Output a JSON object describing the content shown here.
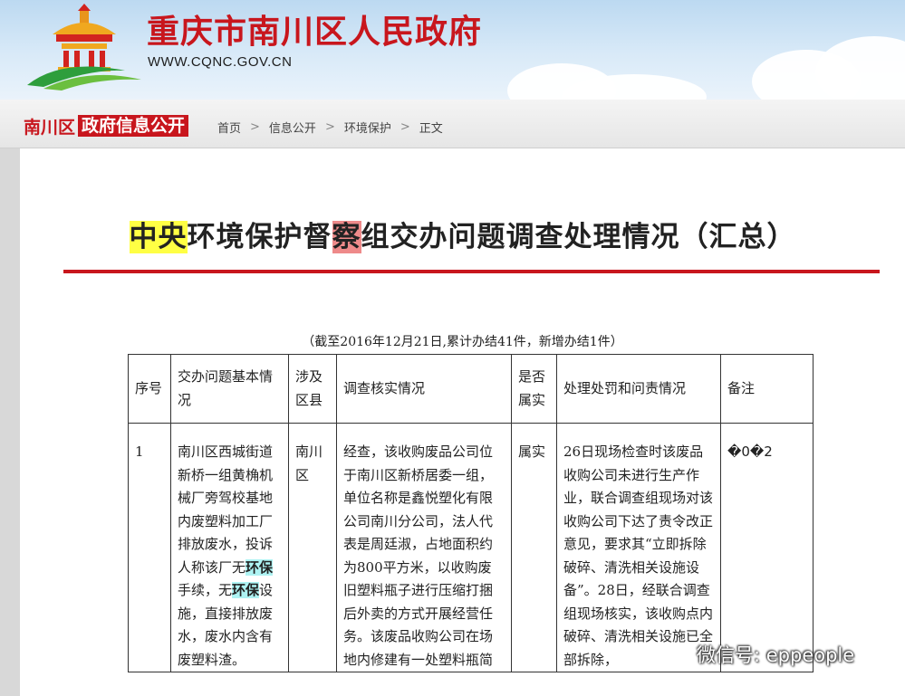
{
  "header": {
    "site_title": "重庆市南川区人民政府",
    "site_url": "WWW.CQNC.GOV.CN"
  },
  "nav": {
    "brand_part1": "南川区",
    "brand_part2": "政府信息公开",
    "breadcrumbs": [
      "首页",
      "信息公开",
      "环境保护",
      "正文"
    ]
  },
  "article": {
    "title_parts": [
      "中央",
      "环境保护督",
      "察",
      "组交办问题调查处理情况（汇总）"
    ],
    "note": "（截至2016年12月21日,累计办结41件，新增办结1件）"
  },
  "table": {
    "headers": [
      "序号",
      "交办问题基本情况",
      "涉及区县",
      "调查核实情况",
      "是否属实",
      "处理处罚和问责情况",
      "备注"
    ],
    "row1": {
      "index": "1",
      "issue_part1": "南川区西城街道新桥一组黄桷机械厂旁驾校基地内废塑料加工厂排放废水，投诉人称该厂无",
      "issue_hl1": "环保",
      "issue_part2": "手续，无",
      "issue_hl2": "环保",
      "issue_part3": "设施，直接排放废水，废水内含有废塑料渣。",
      "district": "南川区",
      "investigation": "经查，该收购废品公司位于南川区新桥居委一组，单位名称是鑫悦塑化有限公司南川分公司，法人代表是周廷淑，占地面积约为800平方米，以收购废旧塑料瓶子进行压缩打捆后外卖的方式开展经营任务。该废品收购公司在场地内修建有一处塑料瓶简",
      "is_true": "属实",
      "handling": "26日现场检查时该废品收购公司未进行生产作业，联合调查组现场对该收购公司下达了责令改正意见，要求其“立即拆除破碎、清洗相关设施设备”。28日，经联合调查组现场核实，该收购点内破碎、清洗相关设施已全部拆除，",
      "remarks": "�0�2"
    }
  },
  "watermark": {
    "text": "微信号: eppeople",
    "icon": "wechat-icon"
  },
  "colors": {
    "brand_red": "#c8161d",
    "highlight_yellow": "#ffff44",
    "highlight_pink": "#ee8a8a",
    "highlight_cyan": "#aef3f3"
  }
}
